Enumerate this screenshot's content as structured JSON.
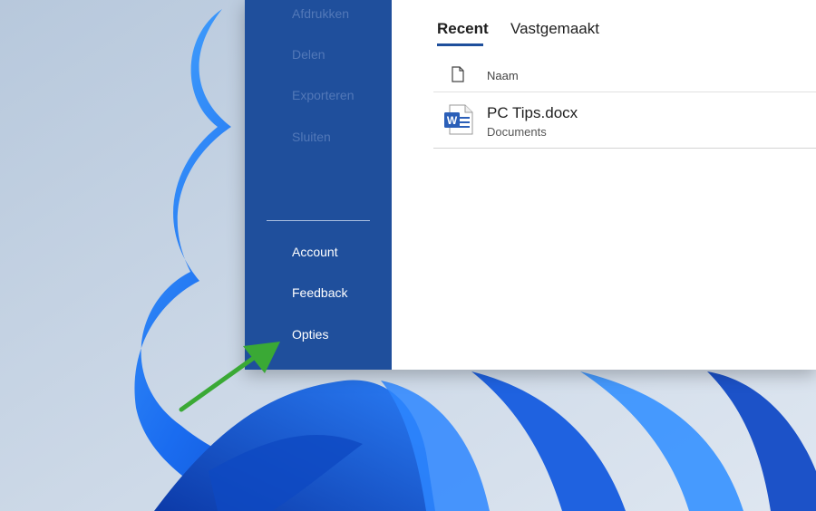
{
  "backstage": {
    "items_top": [
      {
        "label": "Afdrukken"
      },
      {
        "label": "Delen"
      },
      {
        "label": "Exporteren"
      },
      {
        "label": "Sluiten"
      }
    ],
    "items_bottom": [
      {
        "label": "Account"
      },
      {
        "label": "Feedback"
      },
      {
        "label": "Opties"
      }
    ]
  },
  "tabs": [
    {
      "label": "Recent",
      "selected": true
    },
    {
      "label": "Vastgemaakt",
      "selected": false
    }
  ],
  "file_list": {
    "header_name": "Naam",
    "files": [
      {
        "name": "PC Tips.docx",
        "location": "Documents",
        "icon": "word-document-icon"
      }
    ]
  },
  "colors": {
    "backstage_bg": "#1f4f9c",
    "accent": "#1f4f9c",
    "annotation_arrow": "#3aa935"
  }
}
